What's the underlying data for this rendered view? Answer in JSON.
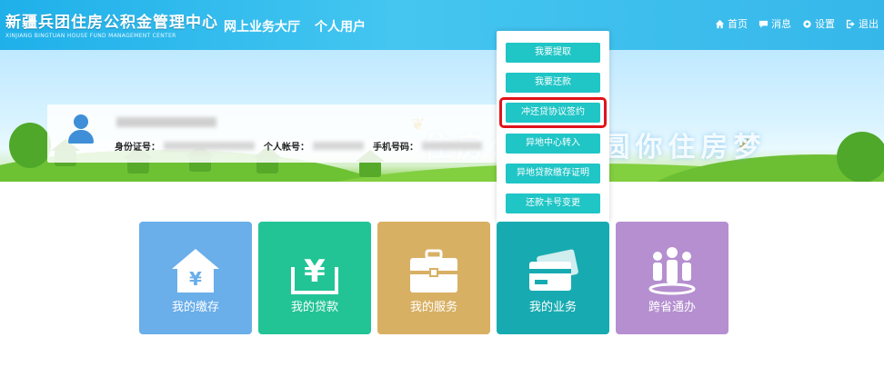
{
  "header": {
    "brand_title": "新疆兵团住房公积金管理中心",
    "brand_subtitle": "XINJIANG BINGTUAN HOUSE FUND MANAGEMENT CENTER",
    "nav": [
      "网上业务大厅",
      "个人用户"
    ],
    "links": [
      {
        "label": "首页",
        "icon": "home-icon"
      },
      {
        "label": "消息",
        "icon": "message-icon"
      },
      {
        "label": "设置",
        "icon": "gear-icon"
      },
      {
        "label": "退出",
        "icon": "logout-icon"
      }
    ]
  },
  "banner": {
    "slogan": "住房公积金 圆你住房梦"
  },
  "user": {
    "name": "",
    "id_label": "身份证号：",
    "id_value": "",
    "account_label": "个人帐号：",
    "account_value": "",
    "phone_label": "手机号码：",
    "phone_value": ""
  },
  "dropdown": {
    "items": [
      "我要提取",
      "我要还款",
      "冲还贷协议签约",
      "异地中心转入",
      "异地贷款缴存证明",
      "还款卡号变更"
    ],
    "highlighted_index": 2,
    "highlight_color": "#e0141b",
    "item_color": "#20c5c6"
  },
  "tiles": [
    {
      "label": "我的缴存",
      "color": "#6aaeea",
      "icon": "house-yen-icon"
    },
    {
      "label": "我的贷款",
      "color": "#22c496",
      "icon": "yen-tray-icon"
    },
    {
      "label": "我的服务",
      "color": "#d8b064",
      "icon": "toolbox-icon"
    },
    {
      "label": "我的业务",
      "color": "#17abb1",
      "icon": "cards-icon"
    },
    {
      "label": "跨省通办",
      "color": "#b58fd0",
      "icon": "people-icon"
    }
  ]
}
